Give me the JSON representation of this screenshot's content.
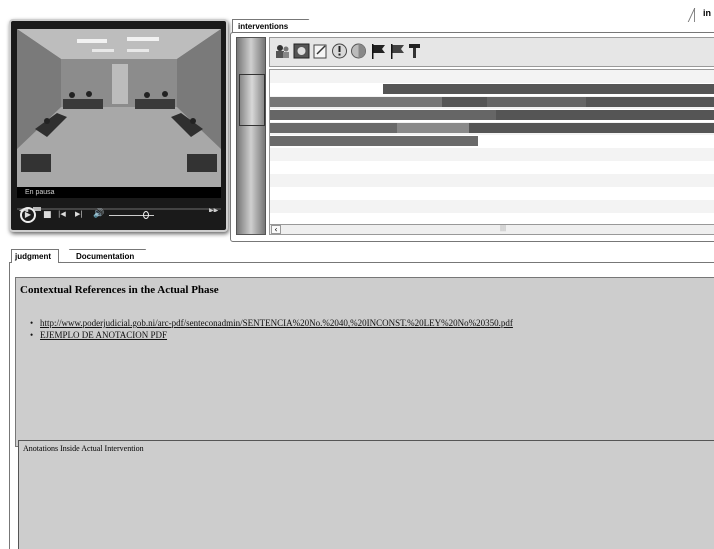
{
  "top_right_tab_label": "in",
  "player": {
    "status_text": "En pausa",
    "controls": {
      "play": "▶",
      "stop": "■",
      "prev": "|◀",
      "next": "▶|",
      "volume": "🔊"
    }
  },
  "interventions": {
    "tab_label": "interventions",
    "toolbar_icons": [
      "user-group-icon",
      "intervention-icon",
      "note-icon",
      "warning-icon",
      "circle-icon",
      "flag-black-icon",
      "flag-dark-icon",
      "pin-icon"
    ],
    "timeline_rows": [
      {
        "segments": [
          {
            "start": 0.25,
            "end": 1.0,
            "tone": "#555555"
          }
        ]
      },
      {
        "segments": [
          {
            "start": 0.0,
            "end": 0.38,
            "tone": "#777777"
          },
          {
            "start": 0.38,
            "end": 0.48,
            "tone": "#555555"
          },
          {
            "start": 0.48,
            "end": 0.7,
            "tone": "#666666"
          },
          {
            "start": 0.7,
            "end": 1.0,
            "tone": "#555555"
          }
        ]
      },
      {
        "segments": [
          {
            "start": 0.0,
            "end": 0.5,
            "tone": "#666666"
          },
          {
            "start": 0.5,
            "end": 1.0,
            "tone": "#555555"
          }
        ]
      },
      {
        "segments": [
          {
            "start": 0.0,
            "end": 0.28,
            "tone": "#6a6a6a"
          },
          {
            "start": 0.28,
            "end": 0.44,
            "tone": "#8a8a8a"
          },
          {
            "start": 0.44,
            "end": 1.0,
            "tone": "#555555"
          }
        ]
      },
      {
        "segments": [
          {
            "start": 0.0,
            "end": 0.46,
            "tone": "#6a6a6a"
          }
        ]
      }
    ]
  },
  "bottom_tabs": {
    "judgment": "judgment",
    "documentation": "Documentation"
  },
  "references": {
    "title": "Contextual References in the Actual Phase",
    "links": [
      "http://www.poderjudicial.gob.ni/arc-pdf/senteconadmin/SENTENCIA%20No.%2040,%20INCONST.%20LEY%20No%20350.pdf",
      "EJEMPLO DE ANOTACION PDF"
    ]
  },
  "annotations": {
    "label": "Anotations Inside Actual Intervention"
  }
}
